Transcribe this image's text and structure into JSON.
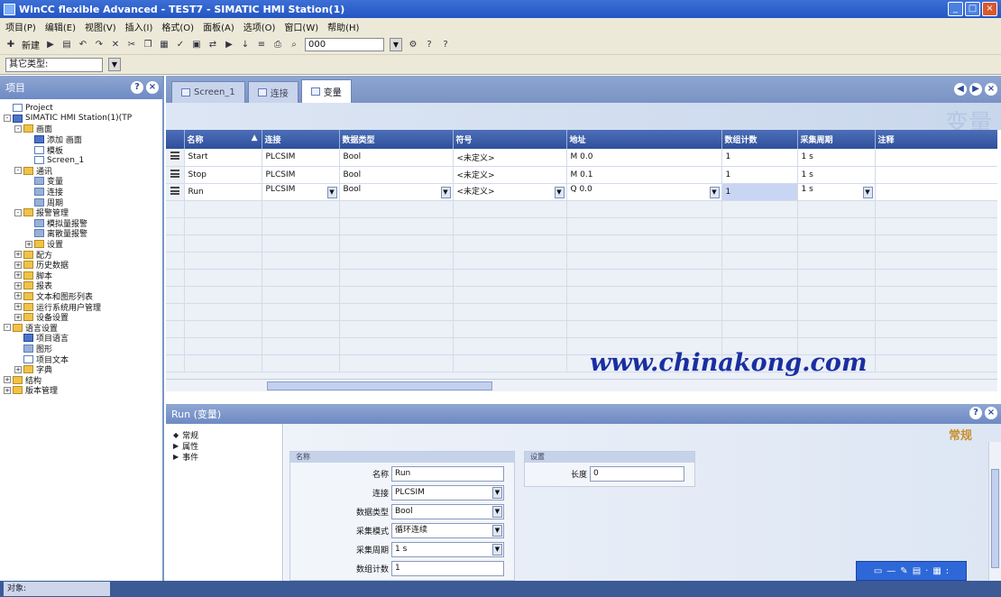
{
  "window": {
    "title": "WinCC flexible Advanced - TEST7 - SIMATIC HMI Station(1)",
    "controls": [
      "_",
      "□",
      "×"
    ]
  },
  "menu": [
    "项目(P)",
    "编辑(E)",
    "视图(V)",
    "插入(I)",
    "格式(O)",
    "面板(A)",
    "选项(O)",
    "窗口(W)",
    "帮助(H)"
  ],
  "toolbar": {
    "new_label": "新建",
    "zoom_value": "000"
  },
  "toolbar2": {
    "object_selector": "其它类型:"
  },
  "project_panel": {
    "title": "项目",
    "tree": [
      {
        "label": "Project",
        "level": 0,
        "icon": "doc",
        "exp": ""
      },
      {
        "label": "SIMATIC HMI Station(1)(TP",
        "level": 0,
        "icon": "blue",
        "exp": "-"
      },
      {
        "label": "画面",
        "level": 1,
        "icon": "folder",
        "exp": "-"
      },
      {
        "label": "添加 画面",
        "level": 2,
        "icon": "blue",
        "exp": ""
      },
      {
        "label": "模板",
        "level": 2,
        "icon": "doc",
        "exp": ""
      },
      {
        "label": "Screen_1",
        "level": 2,
        "icon": "doc",
        "exp": ""
      },
      {
        "label": "通讯",
        "level": 1,
        "icon": "folder",
        "exp": "-"
      },
      {
        "label": "变量",
        "level": 2,
        "icon": "tag",
        "exp": ""
      },
      {
        "label": "连接",
        "level": 2,
        "icon": "tag",
        "exp": ""
      },
      {
        "label": "周期",
        "level": 2,
        "icon": "tag",
        "exp": ""
      },
      {
        "label": "报警管理",
        "level": 1,
        "icon": "folder",
        "exp": "-"
      },
      {
        "label": "模拟量报警",
        "level": 2,
        "icon": "tag",
        "exp": ""
      },
      {
        "label": "离散量报警",
        "level": 2,
        "icon": "tag",
        "exp": ""
      },
      {
        "label": "设置",
        "level": 2,
        "icon": "folder",
        "exp": "+"
      },
      {
        "label": "配方",
        "level": 1,
        "icon": "folder",
        "exp": "+"
      },
      {
        "label": "历史数据",
        "level": 1,
        "icon": "folder",
        "exp": "+"
      },
      {
        "label": "脚本",
        "level": 1,
        "icon": "folder",
        "exp": "+"
      },
      {
        "label": "报表",
        "level": 1,
        "icon": "folder",
        "exp": "+"
      },
      {
        "label": "文本和图形列表",
        "level": 1,
        "icon": "folder",
        "exp": "+"
      },
      {
        "label": "运行系统用户管理",
        "level": 1,
        "icon": "folder",
        "exp": "+"
      },
      {
        "label": "设备设置",
        "level": 1,
        "icon": "folder",
        "exp": "+"
      },
      {
        "label": "语言设置",
        "level": 0,
        "icon": "folder",
        "exp": "-"
      },
      {
        "label": "项目语言",
        "level": 1,
        "icon": "blue",
        "exp": ""
      },
      {
        "label": "图形",
        "level": 1,
        "icon": "tag",
        "exp": ""
      },
      {
        "label": "项目文本",
        "level": 1,
        "icon": "doc",
        "exp": ""
      },
      {
        "label": "字典",
        "level": 1,
        "icon": "folder",
        "exp": "+"
      },
      {
        "label": "结构",
        "level": 0,
        "icon": "folder",
        "exp": "+"
      },
      {
        "label": "版本管理",
        "level": 0,
        "icon": "folder",
        "exp": "+"
      }
    ]
  },
  "editor": {
    "tabs": [
      {
        "label": "Screen_1",
        "active": false
      },
      {
        "label": "连接",
        "active": false
      },
      {
        "label": "变量",
        "active": true
      }
    ],
    "banner_title": "变量",
    "columns": [
      "名称",
      "连接",
      "数据类型",
      "符号",
      "地址",
      "数组计数",
      "采集周期",
      "注释"
    ],
    "rows": [
      [
        "Start",
        "PLCSIM",
        "Bool",
        "<未定义>",
        "M 0.0",
        "1",
        "1 s",
        ""
      ],
      [
        "Stop",
        "PLCSIM",
        "Bool",
        "<未定义>",
        "M 0.1",
        "1",
        "1 s",
        ""
      ],
      [
        "Run",
        "PLCSIM",
        "Bool",
        "<未定义>",
        "Q 0.0",
        "1",
        "1 s",
        ""
      ]
    ],
    "watermark": "www.chinakong.com"
  },
  "properties": {
    "title": "Run (变量)",
    "nav": [
      "常规",
      "属性",
      "事件"
    ],
    "section_title": "常规",
    "group_name": "名称",
    "group_settings": "设置",
    "fields": [
      {
        "label": "名称",
        "value": "Run",
        "dropdown": false
      },
      {
        "label": "连接",
        "value": "PLCSIM",
        "dropdown": true
      },
      {
        "label": "数据类型",
        "value": "Bool",
        "dropdown": true
      },
      {
        "label": "采集模式",
        "value": "循环连续",
        "dropdown": true
      },
      {
        "label": "采集周期",
        "value": "1 s",
        "dropdown": true
      },
      {
        "label": "数组计数",
        "value": "1",
        "dropdown": false
      }
    ],
    "length_label": "长度",
    "length_value": "0"
  },
  "statusbar": {
    "object_tab": "对象:"
  }
}
